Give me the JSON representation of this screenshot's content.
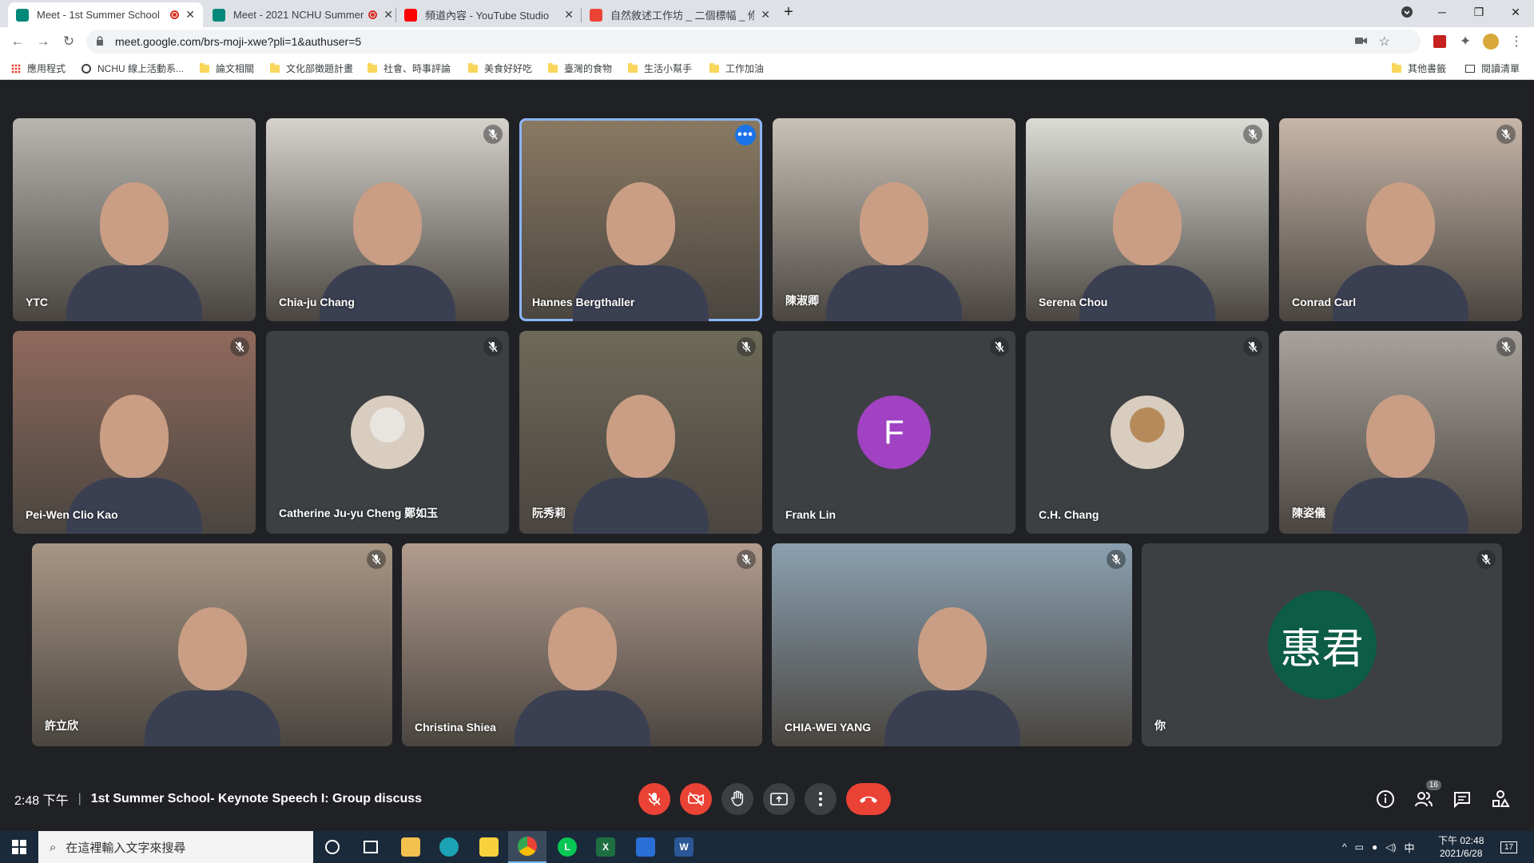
{
  "browser": {
    "tabs": [
      {
        "title": "Meet - 1st Summer School",
        "favicon": "google-meet",
        "recording": true,
        "active": true
      },
      {
        "title": "Meet - 2021 NCHU Summer",
        "favicon": "google-meet",
        "recording": true,
        "active": false
      },
      {
        "title": "頻道內容 - YouTube Studio",
        "favicon": "youtube",
        "recording": false,
        "active": false
      },
      {
        "title": "自然敘述工作坊 _ 二個標幅 _ 修正",
        "favicon": "gmail",
        "recording": false,
        "active": false
      }
    ],
    "url": "meet.google.com/brs-moji-xwe?pli=1&authuser=5",
    "bookmarks": [
      {
        "label": "應用程式",
        "icon": "apps-grid"
      },
      {
        "label": "NCHU 線上活動系...",
        "icon": "globe"
      },
      {
        "label": "論文相關",
        "icon": "folder"
      },
      {
        "label": "文化部徵題計畫",
        "icon": "folder"
      },
      {
        "label": "社會、時事評論",
        "icon": "folder"
      },
      {
        "label": "美食好好吃",
        "icon": "folder"
      },
      {
        "label": "臺灣的食物",
        "icon": "folder"
      },
      {
        "label": "生活小幫手",
        "icon": "folder"
      },
      {
        "label": "工作加油",
        "icon": "folder"
      }
    ],
    "bookmarks_right": [
      {
        "label": "其他書籤",
        "icon": "folder"
      },
      {
        "label": "閱讀清單",
        "icon": "reading-list"
      }
    ]
  },
  "meet": {
    "participants": [
      {
        "name": "YTC",
        "muted": false,
        "type": "video",
        "tone": "#b9b6b2"
      },
      {
        "name": "Chia-ju Chang",
        "muted": true,
        "type": "video",
        "tone": "#d6d2cc"
      },
      {
        "name": "Hannes Bergthaller",
        "muted": false,
        "type": "video",
        "active": true,
        "tone": "#8a7a62"
      },
      {
        "name": "陳淑卿",
        "muted": false,
        "type": "video",
        "tone": "#c9c2b8"
      },
      {
        "name": "Serena Chou",
        "muted": true,
        "type": "video",
        "tone": "#dcdcd6"
      },
      {
        "name": "Conrad Carl",
        "muted": true,
        "type": "video",
        "tone": "#c7b6a8"
      },
      {
        "name": "Pei-Wen Clio Kao",
        "muted": true,
        "type": "video",
        "tone": "#8f6a5c"
      },
      {
        "name": "Catherine Ju-yu Cheng 鄭如玉",
        "muted": true,
        "type": "photo-avatar",
        "tone": "#e8e4df"
      },
      {
        "name": "阮秀莉",
        "muted": true,
        "type": "video",
        "tone": "#6e6a58"
      },
      {
        "name": "Frank Lin",
        "muted": true,
        "type": "letter-avatar",
        "letter": "F",
        "tone": "#a142c2"
      },
      {
        "name": "C.H. Chang",
        "muted": true,
        "type": "photo-avatar",
        "tone": "#b78a5c"
      },
      {
        "name": "陳姿儀",
        "muted": true,
        "type": "video",
        "tone": "#a8a29c"
      },
      {
        "name": "許立欣",
        "muted": true,
        "type": "video",
        "tone": "#a89684"
      },
      {
        "name": "Christina Shiea",
        "muted": true,
        "type": "video",
        "tone": "#b39c8e"
      },
      {
        "name": "CHIA-WEI YANG",
        "muted": true,
        "type": "video",
        "tone": "#8aa0b0"
      },
      {
        "name": "你",
        "muted": true,
        "type": "letter-avatar",
        "letter": "惠君",
        "tone": "#0d5c46"
      }
    ],
    "time": "2:48 下午",
    "meeting_title": "1st Summer School- Keynote Speech I: Group discuss",
    "people_count": "16"
  },
  "taskbar": {
    "search_placeholder": "在這裡輸入文字來搜尋",
    "clock_time": "下午 02:48",
    "clock_date": "2021/6/28",
    "ime": "中",
    "notifications": "17"
  },
  "colors": {
    "meet_bg": "#202124",
    "tile_bg": "#3c4043",
    "active_border": "#8ab4f8",
    "hangup_red": "#ea4335",
    "taskbar_bg": "#1b2a3a"
  }
}
